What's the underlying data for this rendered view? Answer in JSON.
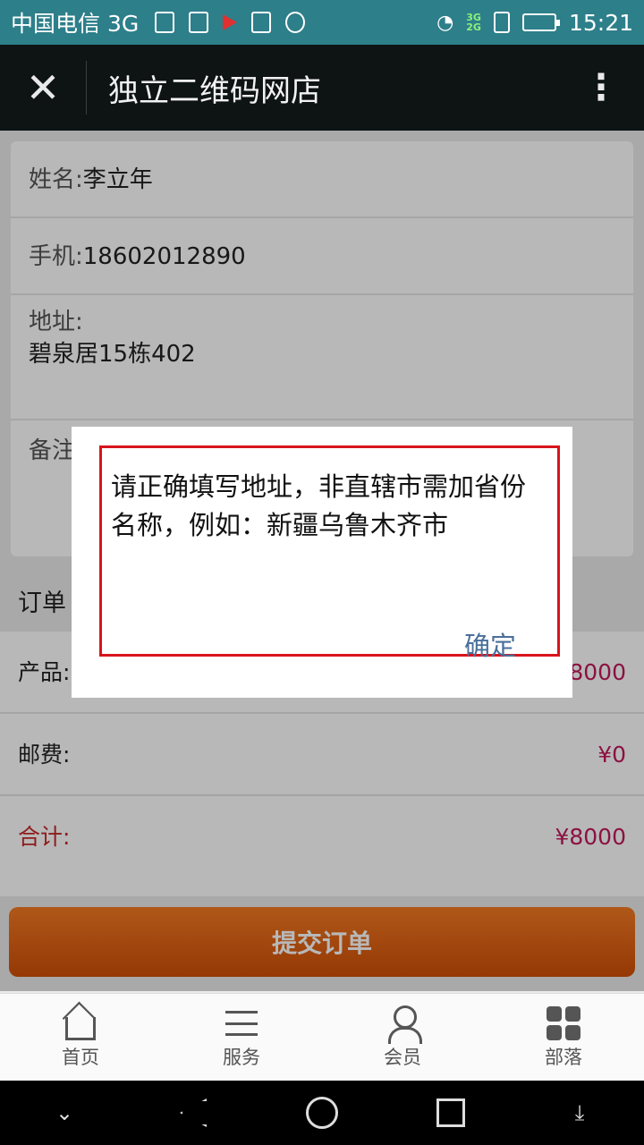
{
  "status_bar": {
    "carrier": "中国电信 3G",
    "time": "15:21",
    "net_top": "3G",
    "net_bottom": "2G"
  },
  "header": {
    "title": "独立二维码网店",
    "close_icon": "close-icon",
    "more_icon": "more-vertical-icon"
  },
  "form": {
    "name_label": "姓名:",
    "name_value": "李立年",
    "phone_label": "手机:",
    "phone_value": "18602012890",
    "address_label": "地址:",
    "address_value": "碧泉居15栋402",
    "note_label": "备注"
  },
  "order": {
    "section_title": "订单",
    "product_label": "产品:",
    "product_value": "¥8000",
    "shipping_label": "邮费:",
    "shipping_value": "¥0",
    "total_label": "合计:",
    "total_value": "¥8000"
  },
  "submit_label": "提交订单",
  "tabbar": {
    "items": [
      {
        "label": "首页",
        "icon": "home-icon"
      },
      {
        "label": "服务",
        "icon": "menu-icon"
      },
      {
        "label": "会员",
        "icon": "user-icon"
      },
      {
        "label": "部落",
        "icon": "grid-icon"
      }
    ]
  },
  "dialog": {
    "message": "请正确填写地址，非直辖市需加省份名称，例如：新疆乌鲁木齐市",
    "ok_label": "确定"
  },
  "colors": {
    "status_bar": "#2d7f8a",
    "title_bar": "#0e1314",
    "submit": "#e0651a",
    "price": "#c2185b",
    "dialog_border": "#d8141c",
    "ok_text": "#4a6f9a"
  }
}
